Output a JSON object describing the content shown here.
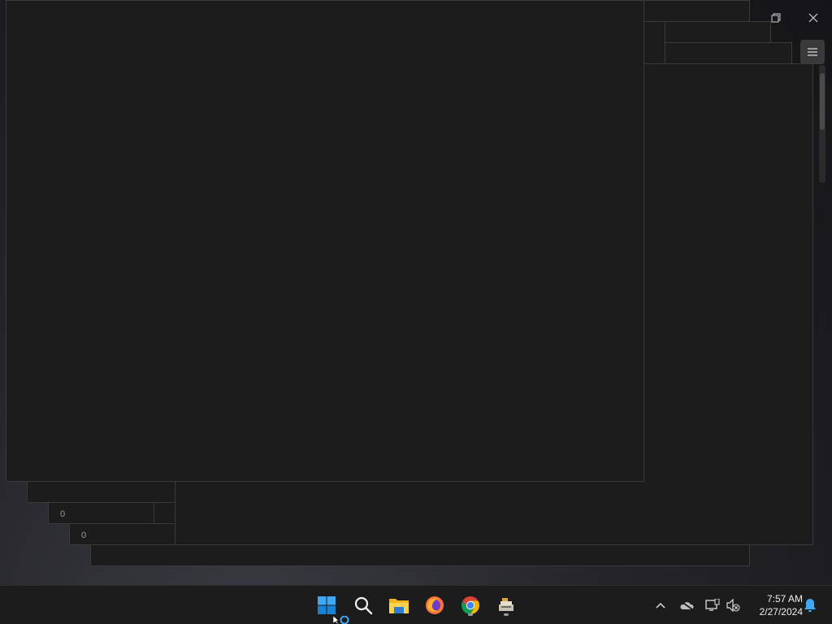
{
  "desktop": {
    "background_colors": [
      "#151518",
      "#24242a",
      "#3c3c44"
    ],
    "window_labels": [
      "0 ",
      "0 "
    ]
  },
  "window_controls": {
    "restore_icon": "restore-icon",
    "close_icon": "close-icon",
    "menu_icon": "hamburger-menu-icon"
  },
  "taskbar": {
    "apps": [
      {
        "name": "Start",
        "icon": "windows-start-icon"
      },
      {
        "name": "Search",
        "icon": "search-icon"
      },
      {
        "name": "File Explorer",
        "icon": "file-explorer-icon"
      },
      {
        "name": "Firefox",
        "icon": "firefox-icon"
      },
      {
        "name": "Google Chrome",
        "icon": "chrome-icon",
        "running": true
      },
      {
        "name": "App",
        "icon": "app-icon",
        "running": true
      }
    ],
    "tray": {
      "chevron": "chevron-up-icon",
      "onedrive": "onedrive-offline-icon",
      "network": "network-icon",
      "volume": "volume-muted-icon",
      "notification": "bell-icon"
    },
    "time": "7:57 AM",
    "date": "2/27/2024"
  }
}
